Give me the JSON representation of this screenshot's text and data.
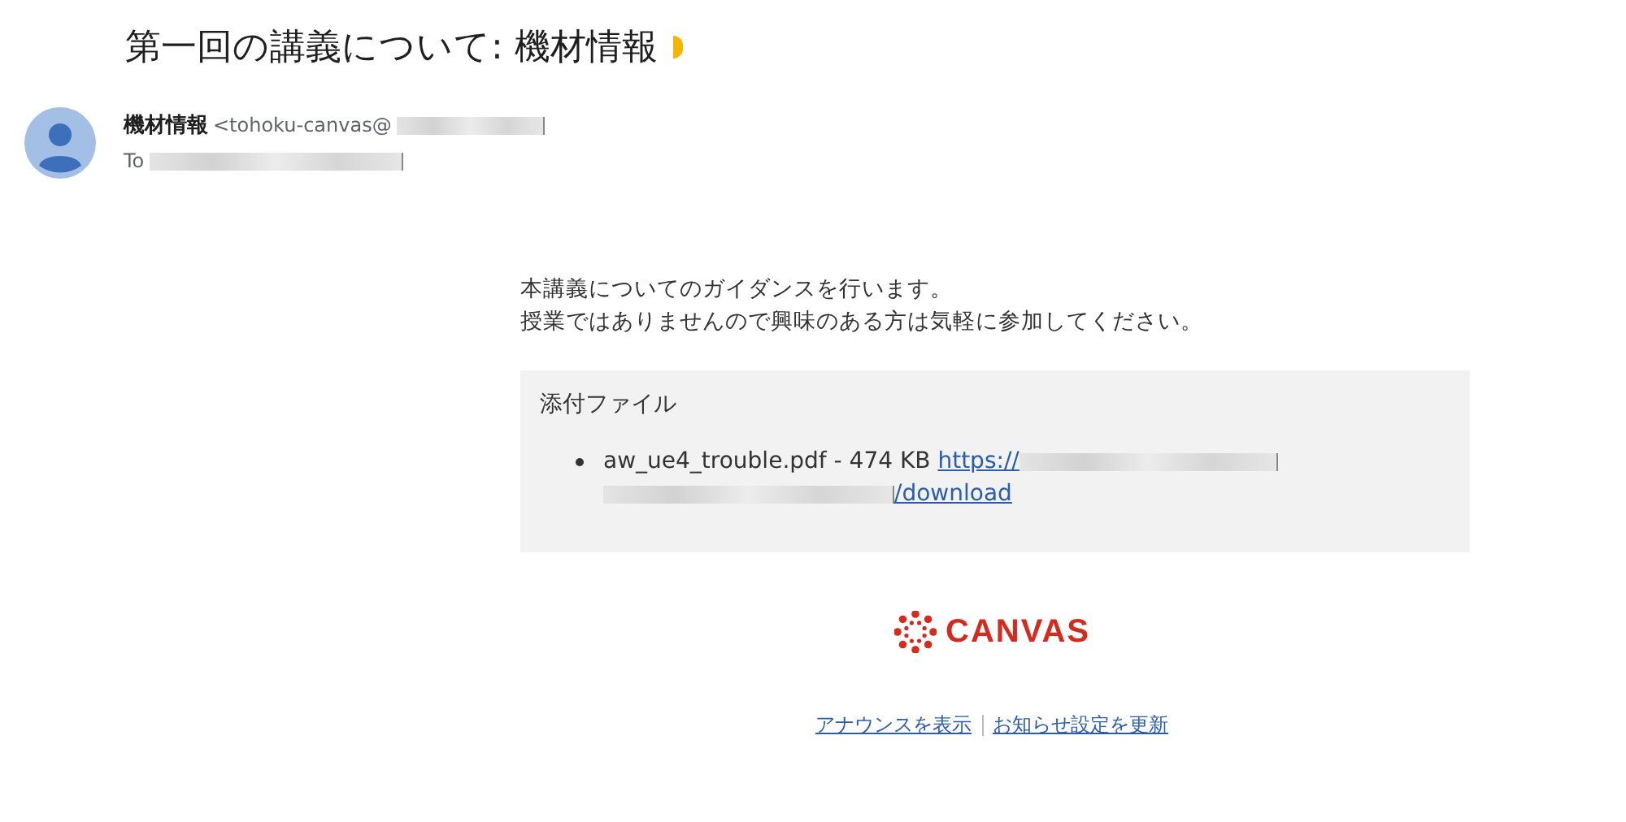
{
  "subject": "第一回の講義について: 機材情報",
  "sender": {
    "name": "機材情報",
    "address": "<tohoku-canvas@"
  },
  "recipient": {
    "label": "To"
  },
  "body": {
    "paragraphs": [
      "本講義についてのガイダンスを行います。",
      "授業ではありませんので興味のある方は気軽に参加してください。"
    ],
    "attachments": {
      "heading": "添付ファイル",
      "items": [
        {
          "file": "aw_ue4_trouble.pdf - 474 KB",
          "link_start": "https://",
          "link_end": "/download"
        }
      ]
    }
  },
  "logo": {
    "text": "CANVAS"
  },
  "footer_links": [
    "アナウンスを表示",
    "お知らせ設定を更新"
  ]
}
